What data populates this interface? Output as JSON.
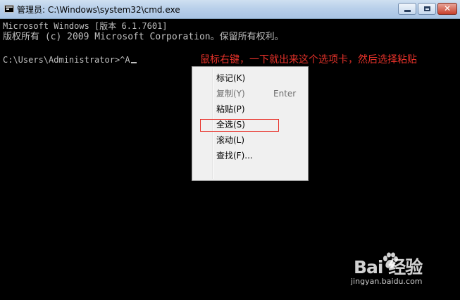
{
  "window": {
    "title": "管理员: C:\\Windows\\system32\\cmd.exe",
    "controls": {
      "minimize": "—",
      "maximize": "□",
      "close": "✕"
    }
  },
  "console": {
    "lines": [
      "Microsoft Windows [版本 6.1.7601]",
      "版权所有 (c) 2009 Microsoft Corporation。保留所有权利。",
      "C:\\Users\\Administrator>^A"
    ]
  },
  "annotation": {
    "text": "鼠标右键，一下就出来这个选项卡，然后选择粘贴",
    "color": "#e8322a"
  },
  "context_menu": {
    "items": [
      {
        "label": "标记(K)",
        "shortcut": "",
        "enabled": true
      },
      {
        "label": "复制(Y)",
        "shortcut": "Enter",
        "enabled": false
      },
      {
        "label": "粘贴(P)",
        "shortcut": "",
        "enabled": true,
        "highlighted": true
      },
      {
        "label": "全选(S)",
        "shortcut": "",
        "enabled": true
      },
      {
        "label": "滚动(L)",
        "shortcut": "",
        "enabled": true
      },
      {
        "label": "查找(F)...",
        "shortcut": "",
        "enabled": true
      }
    ]
  },
  "watermark": {
    "logo": "Bai   经验",
    "url": "jingyan.baidu.com"
  }
}
